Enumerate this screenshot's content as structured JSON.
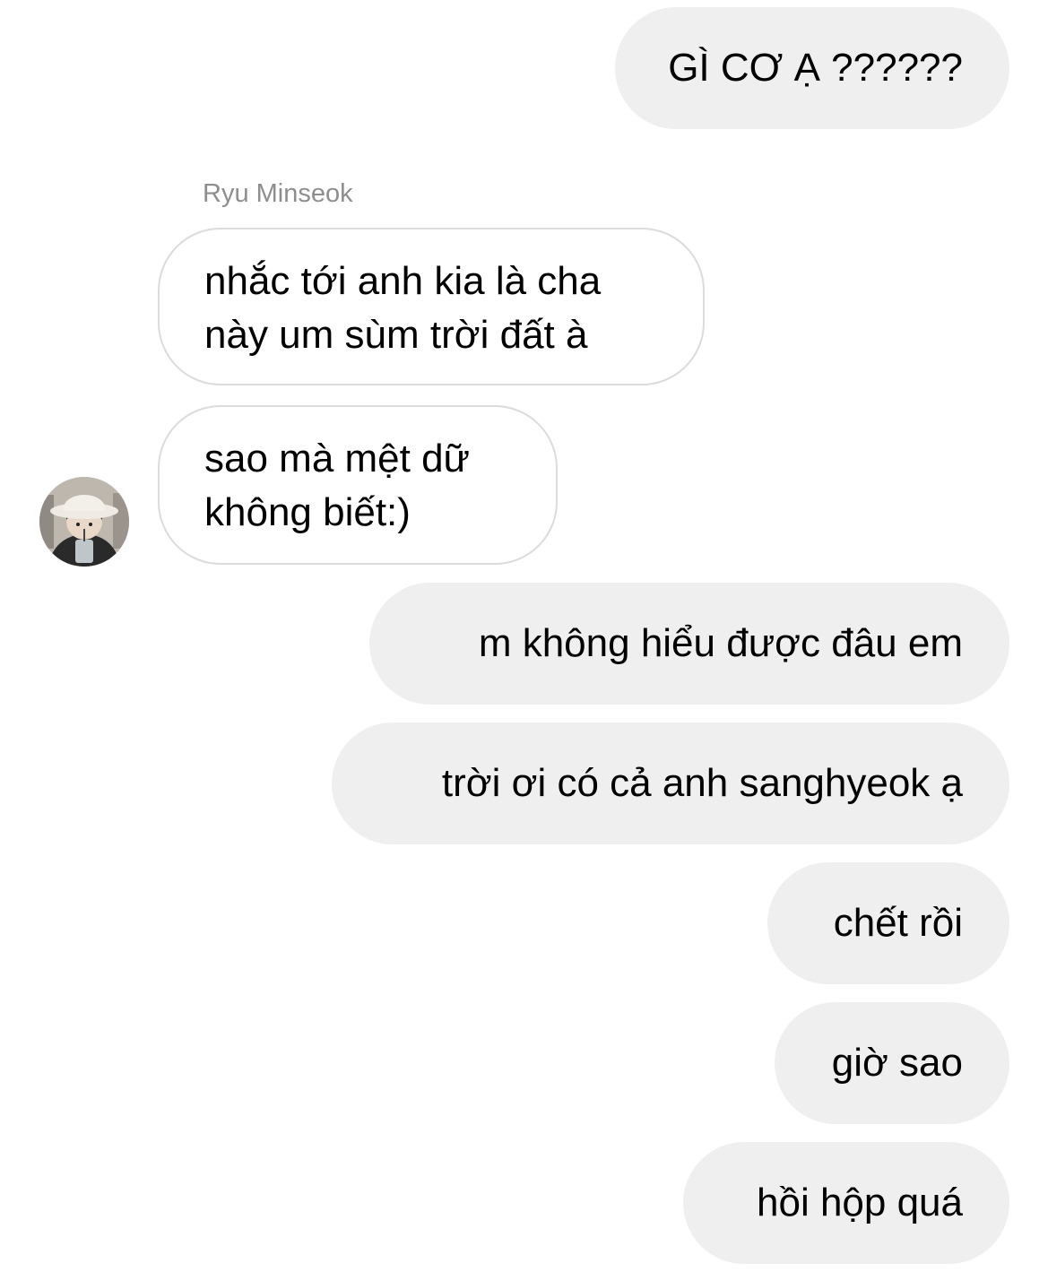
{
  "conversation": {
    "sender_name": "Ryu Minseok",
    "avatar_icon": "user-avatar-photo",
    "colors": {
      "outgoing_bubble": "#efefef",
      "incoming_border": "#dbdbdb",
      "sender_name": "#8e8e8e",
      "text": "#000000"
    },
    "messages": {
      "m1": "GÌ CƠ Ạ ??????",
      "m2": {
        "line1": "nhắc tới anh kia là cha",
        "line2": "này um sùm trời đất à"
      },
      "m3": {
        "line1": "sao mà mệt dữ",
        "line2": "không biết:)"
      },
      "m4": "m không hiểu được đâu em",
      "m5": "trời ơi có cả anh sanghyeok ạ",
      "m6": "chết rồi",
      "m7": "giờ sao",
      "m8": "hồi hộp quá"
    }
  }
}
